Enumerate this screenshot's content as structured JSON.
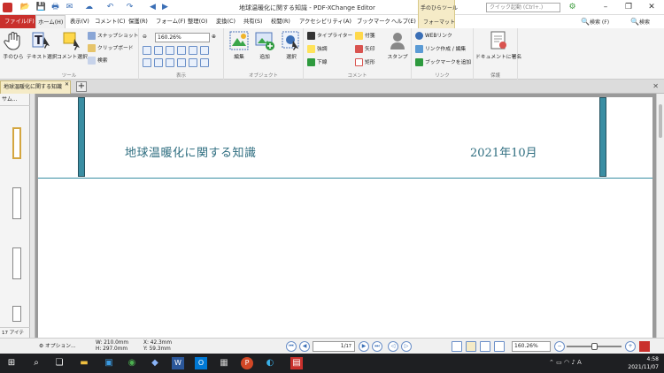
{
  "window": {
    "title": "地球温暖化に関する知識 - PDF-XChange Editor",
    "quick_search_placeholder": "クイック起動 (Ctrl+.)"
  },
  "tabs": [
    {
      "label": "ファイル(F)"
    },
    {
      "label": "ホーム(H)"
    },
    {
      "label": "表示(V)"
    },
    {
      "label": "コメント(C)"
    },
    {
      "label": "保護(R)"
    },
    {
      "label": "フォーム(F)"
    },
    {
      "label": "整理(O)"
    },
    {
      "label": "変換(C)"
    },
    {
      "label": "共有(S)"
    },
    {
      "label": "校閲(R)"
    },
    {
      "label": "アクセシビリティ(A)"
    },
    {
      "label": "ブックマーク"
    },
    {
      "label": "ヘルプ(E)"
    }
  ],
  "context_group": {
    "label": "手のひらツール",
    "tab": "フォーマット"
  },
  "search_buttons": [
    "検索 (F)",
    "検索"
  ],
  "ribbon": {
    "tools": {
      "label": "ツール",
      "hand": "手のひら",
      "text_select": "テキスト選択",
      "comment_select": "コメント選択",
      "snapshot": "スナップショット",
      "clipboard": "クリップボード",
      "search": "検索"
    },
    "view": {
      "label": "表示",
      "zoom": "160.26%"
    },
    "objects": {
      "label": "オブジェクト",
      "edit": "編集",
      "add": "追加",
      "select": "選択"
    },
    "comments": {
      "label": "コメント",
      "typewriter": "タイプライター",
      "sticky": "付箋",
      "underline": "下線",
      "highlight": "強調",
      "arrow": "矢印",
      "rectangle": "矩形",
      "stamp": "スタンプ"
    },
    "links": {
      "label": "リンク",
      "web": "WEBリンク",
      "create": "リンク作成 / 編集",
      "bookmark": "ブックマークを追加"
    },
    "protect": {
      "label": "保護",
      "sign": "ドキュメントに署名"
    }
  },
  "document_tab": {
    "label": "地球温暖化に関する知識"
  },
  "left_panel": {
    "header": "サム...",
    "footer": "17 アイテ"
  },
  "document": {
    "title": "地球温暖化に関する知識",
    "date": "2021年10月"
  },
  "status": {
    "options": "オプション...",
    "width": "W: 210.0mm",
    "height": "H: 297.0mm",
    "x": "X:  42.3mm",
    "y": "Y:  59.3mm",
    "page": "1/",
    "page_total": "17",
    "zoom": "160.26%"
  },
  "taskbar": {
    "time": "4:58",
    "date": "2021/11/07",
    "ime": "A"
  }
}
